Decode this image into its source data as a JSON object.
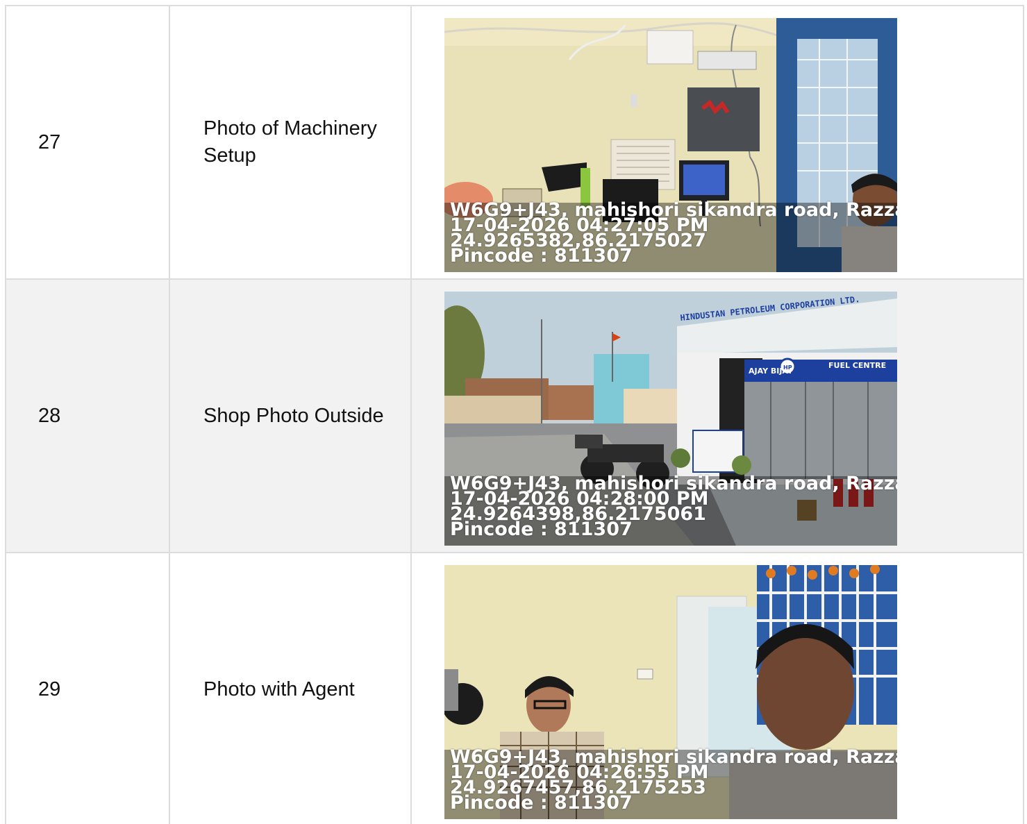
{
  "rows": [
    {
      "number": "27",
      "label": "Photo of Machinery Setup",
      "photo_subject": "office interior with machinery setup",
      "stamp": {
        "address": "W6G9+J43, mahishori sikandra road, Razza",
        "datetime": "17-04-2026 04:27:05 PM",
        "coords": "24.9265382,86.2175027",
        "pincode": "Pincode : 811307"
      }
    },
    {
      "number": "28",
      "label": "Shop Photo Outside",
      "photo_subject": "HP fuel station exterior",
      "sign_text": {
        "corporation": "HINDUSTAN PETROLEUM CORPORATION LTD.",
        "dealer": "AJAY BIJAY",
        "brand": "HP",
        "centre": "FUEL CENTRE"
      },
      "stamp": {
        "address": "W6G9+J43, mahishori sikandra road, Razza",
        "datetime": "17-04-2026 04:28:00 PM",
        "coords": "24.9264398,86.2175061",
        "pincode": "Pincode : 811307"
      }
    },
    {
      "number": "29",
      "label": "Photo with Agent",
      "photo_subject": "selfie with agent in office",
      "stamp": {
        "address": "W6G9+J43, mahishori sikandra road, Razza",
        "datetime": "17-04-2026 04:26:55 PM",
        "coords": "24.9267457,86.2175253",
        "pincode": "Pincode : 811307"
      }
    }
  ]
}
